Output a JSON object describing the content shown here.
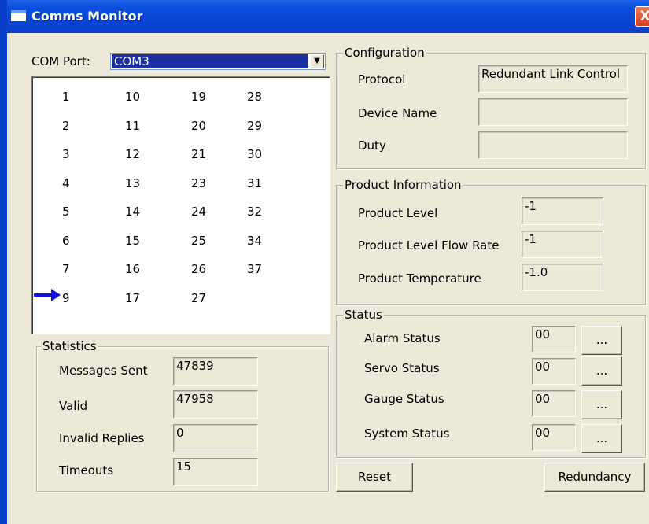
{
  "window": {
    "title": "Comms Monitor",
    "close_glyph": "X"
  },
  "com_port": {
    "label": "COM Port:",
    "selected": "COM3"
  },
  "port_list": {
    "columns": [
      [
        "1",
        "2",
        "3",
        "4",
        "5",
        "6",
        "7",
        "9"
      ],
      [
        "10",
        "11",
        "12",
        "13",
        "14",
        "15",
        "16",
        "17"
      ],
      [
        "19",
        "20",
        "21",
        "23",
        "24",
        "25",
        "26",
        "27"
      ],
      [
        "28",
        "29",
        "30",
        "31",
        "32",
        "34",
        "37"
      ]
    ],
    "current": "9",
    "marker_icon": "arrow-right-icon"
  },
  "statistics": {
    "title": "Statistics",
    "messages_sent": {
      "label": "Messages Sent",
      "value": "47839"
    },
    "valid": {
      "label": "Valid",
      "value": "47958"
    },
    "invalid": {
      "label": "Invalid Replies",
      "value": "0"
    },
    "timeouts": {
      "label": "Timeouts",
      "value": "15"
    }
  },
  "configuration": {
    "title": "Configuration",
    "protocol": {
      "label": "Protocol",
      "value": "Redundant Link Control"
    },
    "device_name": {
      "label": "Device Name",
      "value": ""
    },
    "duty": {
      "label": "Duty",
      "value": ""
    }
  },
  "product_info": {
    "title": "Product Information",
    "level": {
      "label": "Product Level",
      "value": "-1"
    },
    "flow_rate": {
      "label": "Product Level Flow Rate",
      "value": "-1"
    },
    "temperature": {
      "label": "Product Temperature",
      "value": "-1.0"
    }
  },
  "status": {
    "title": "Status",
    "alarm": {
      "label": "Alarm Status",
      "value": "00"
    },
    "servo": {
      "label": "Servo Status",
      "value": "00"
    },
    "gauge": {
      "label": "Gauge Status",
      "value": "00"
    },
    "system": {
      "label": "System Status",
      "value": "00"
    },
    "detail_label": "..."
  },
  "buttons": {
    "reset": "Reset",
    "redundancy": "Redundancy"
  },
  "colors": {
    "titlebar": "#0a3fc9",
    "selection": "#1c2fa3",
    "face": "#ece9d8",
    "marker": "#1010e0"
  }
}
